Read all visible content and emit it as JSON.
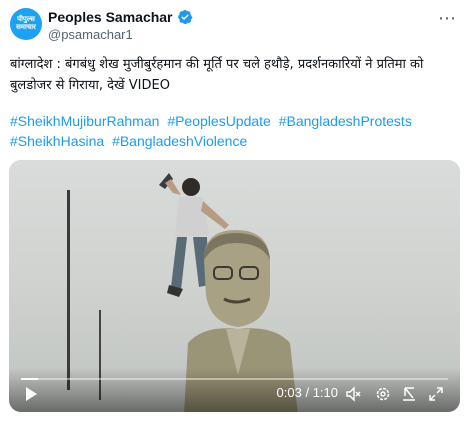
{
  "account": {
    "avatar_text_line1": "पीपुल्स",
    "avatar_text_line2": "समाचार",
    "display_name": "Peoples Samachar",
    "handle": "@psamachar1"
  },
  "tweet": {
    "text": "बांग्लादेश : बंगबंधु शेख मुजीबुर्रहमान की मूर्ति पर चले हथौड़े, प्रदर्शनकारियों ने प्रतिमा को बुलडोजर से गिराया, देखें VIDEO",
    "hashtags": [
      "#SheikhMujiburRahman",
      "#PeoplesUpdate",
      "#BangladeshProtests",
      "#SheikhHasina",
      "#BangladeshViolence"
    ]
  },
  "video": {
    "current_time": "0:03",
    "duration": "1:10",
    "progress_fraction": 0.04
  },
  "colors": {
    "accent": "#1d9bf0",
    "verified": "#1d9bf0"
  },
  "icons": [
    "more-options-icon",
    "verified-badge-icon",
    "play-icon",
    "volume-icon",
    "settings-icon",
    "expand-icon",
    "fullscreen-icon"
  ]
}
